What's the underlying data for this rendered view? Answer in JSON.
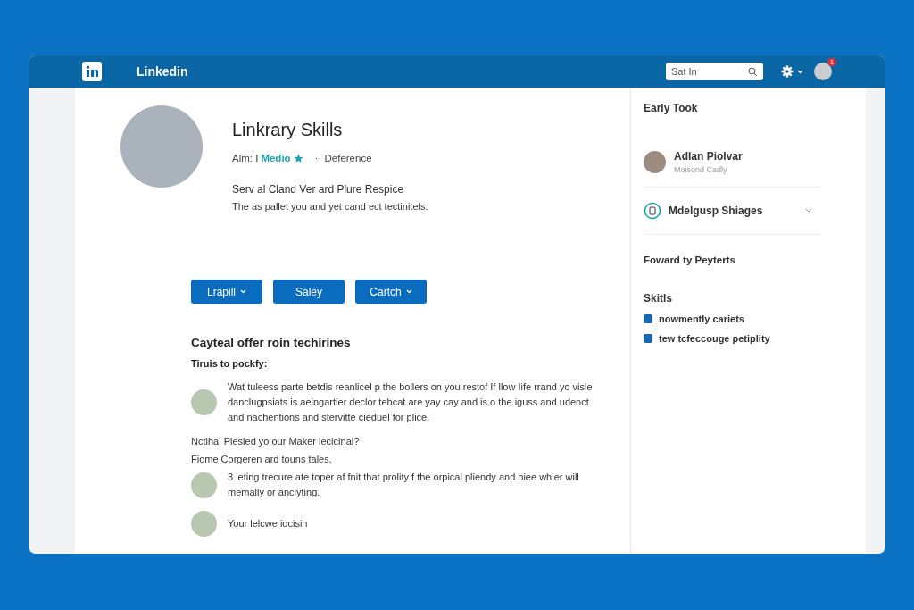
{
  "header": {
    "brand": "Linkedin",
    "search": {
      "placeholder": "Sat In"
    },
    "notification_badge": "1"
  },
  "profile": {
    "name": "Linkrary Skills",
    "meta_prefix": "Alm: I",
    "meta_link": "Medio",
    "meta_suffix": "·· Deference",
    "headline": "Serv al Cland Ver ard Plure Respice",
    "subline": "The as pallet you and yet cand ect tectinitels."
  },
  "actions": [
    {
      "label": "Lrapill",
      "dropdown": true
    },
    {
      "label": "Saley",
      "dropdown": false
    },
    {
      "label": "Cartch",
      "dropdown": true
    }
  ],
  "feed": {
    "title": "Cayteal offer roin techirines",
    "subtitle": "Tiruis to pockfy:",
    "items": [
      {
        "kind": "post",
        "text": "Wat tuleess parte betdis reanlicel p the bollers on you restof If llow Iife rrand yo visle danclugpsiats is aeingartier declor tebcat are yay cay and is o the iguss and udenct and nachentions and stervitte cieduel for plice."
      },
      {
        "kind": "note",
        "text": "Nctihal Piesled yo our Maker leclcinal?"
      },
      {
        "kind": "note",
        "text": "Fiome Corgeren ard touns tales."
      },
      {
        "kind": "post",
        "text": "3 leting trecure ate toper af fnit that prolity f the orpical pliendy and biee whier will memally or anclyting."
      },
      {
        "kind": "post",
        "text": "Your lelcwe iocisin"
      }
    ]
  },
  "sidebar": {
    "title": "Early Took",
    "person": {
      "name": "Adlan Piolvar",
      "role": "Moisond Cadly"
    },
    "group": {
      "name": "Mdelgusp Shiages",
      "expanded": false
    },
    "link": "Foward ty Peyterts",
    "skills_title": "Skitls",
    "skills": [
      "nowmently cariets",
      "tew tcfeccouge petiplity"
    ]
  }
}
